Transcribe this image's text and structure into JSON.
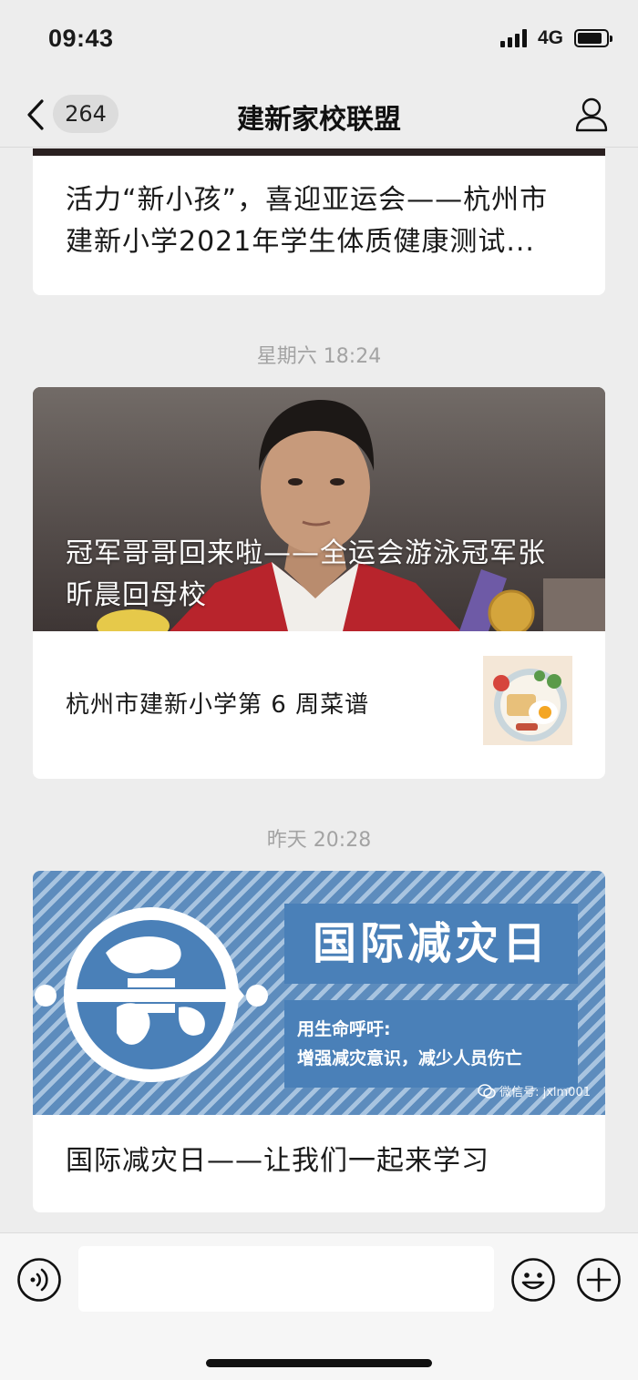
{
  "status_bar": {
    "time": "09:43",
    "network": "4G",
    "battery_level": 0.85
  },
  "nav": {
    "unread_count": "264",
    "title": "建新家校联盟",
    "back_icon": "chevron-left-icon",
    "profile_icon": "person-icon"
  },
  "feed": {
    "card1": {
      "title": "活力“新小孩”，喜迎亚运会——杭州市建新小学2021年学生体质健康测试..."
    },
    "timestamp1": "星期六 18:24",
    "card2": {
      "hero_title": "冠军哥哥回来啦——全运会游泳冠军张昕晨回母校",
      "sub_title": "杭州市建新小学第 6 周菜谱"
    },
    "timestamp2": "昨天 20:28",
    "card3": {
      "banner_title": "国际减灾日",
      "banner_line1": "用生命呼吁:",
      "banner_line2": "增强减灾意识，减少人员伤亡",
      "watermark": "微信号: jxlm001",
      "title": "国际减灾日——让我们一起来学习"
    }
  },
  "input_bar": {
    "placeholder": "",
    "voice_icon": "voice-icon",
    "emoji_icon": "emoji-icon",
    "plus_icon": "plus-icon"
  },
  "colors": {
    "background": "#ededed",
    "card": "#ffffff",
    "timestamp": "#a3a3a3",
    "banner_blue": "#4a80b8"
  }
}
